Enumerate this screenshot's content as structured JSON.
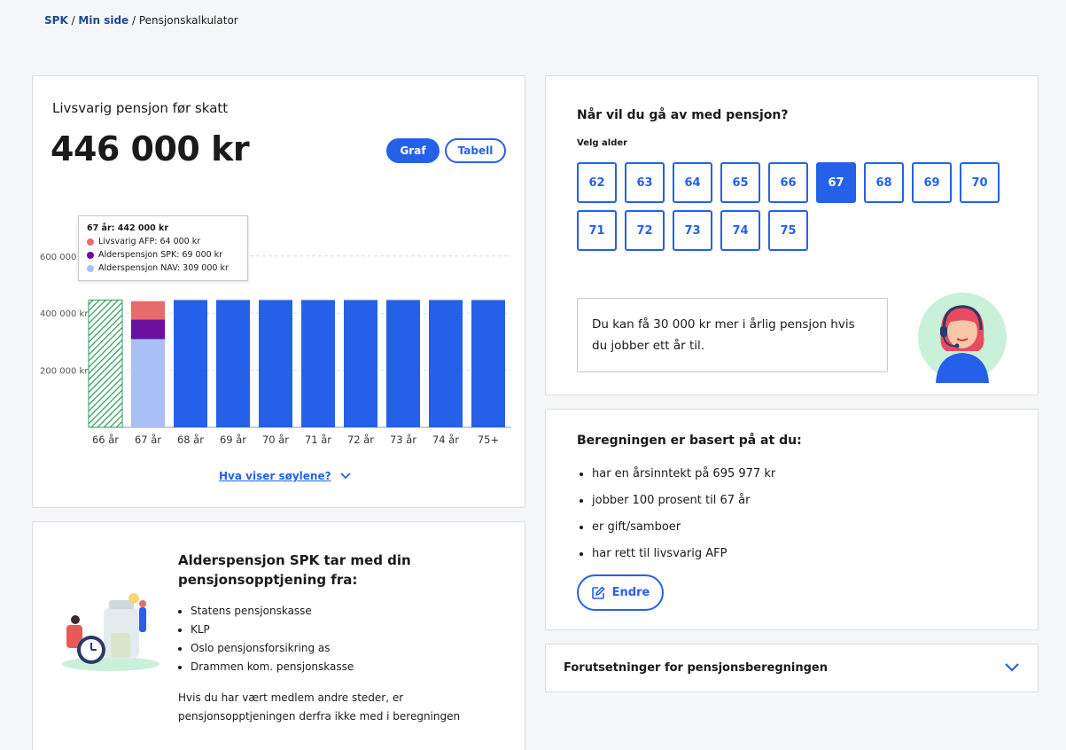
{
  "breadcrumb": {
    "home": "SPK",
    "sep1": " / ",
    "mypage": "Min side",
    "sep2": " / ",
    "current": "Pensjonskalkulator"
  },
  "chart_card": {
    "label": "Livsvarig pensjon før skatt",
    "amount": "446 000 kr",
    "toggle_graf": "Graf",
    "toggle_tabell": "Tabell",
    "more_link": "Hva viser søylene?"
  },
  "tooltip": {
    "title": "67 år: 442 000 kr",
    "rows": [
      {
        "label": "Livsvarig AFP: 64 000 kr",
        "color": "#e86b6b"
      },
      {
        "label": "Alderspensjon SPK: 69 000 kr",
        "color": "#6a0f9e"
      },
      {
        "label": "Alderspensjon NAV: 309 000 kr",
        "color": "#a9bff5"
      }
    ]
  },
  "chart_data": {
    "type": "bar",
    "categories": [
      "66 år",
      "67 år",
      "68 år",
      "69 år",
      "70 år",
      "71 år",
      "72 år",
      "73 år",
      "74 år",
      "75+"
    ],
    "yticks": [
      "200 000 kr",
      "400 000 kr",
      "600 000 kr"
    ],
    "ylim": [
      0,
      600000
    ],
    "colors": {
      "main": "#2561e8",
      "hatch": "#2e9e5b",
      "afp": "#e86b6b",
      "spk": "#6a0f9e",
      "nav": "#a9bff5"
    },
    "series": [
      {
        "name": "Livsvarig AFP",
        "values": [
          null,
          64000,
          null,
          null,
          null,
          null,
          null,
          null,
          null,
          null
        ]
      },
      {
        "name": "Alderspensjon SPK",
        "values": [
          null,
          69000,
          null,
          null,
          null,
          null,
          null,
          null,
          null,
          null
        ]
      },
      {
        "name": "Alderspensjon NAV",
        "values": [
          null,
          309000,
          null,
          null,
          null,
          null,
          null,
          null,
          null,
          null
        ]
      }
    ],
    "totals": [
      446000,
      442000,
      446000,
      446000,
      446000,
      446000,
      446000,
      446000,
      446000,
      446000
    ]
  },
  "info_card": {
    "title": "Alderspensjon SPK tar med din pensjonsopptjening fra:",
    "items": [
      "Statens pensjonskasse",
      "KLP",
      "Oslo pensjonsforsikring as",
      "Drammen kom. pensjonskasse"
    ],
    "footer": "Hvis du har vært medlem andre steder, er pensjonsopptjeningen derfra ikke med i beregningen"
  },
  "age_card": {
    "title": "Når vil du gå av med pensjon?",
    "subtitle": "Velg alder",
    "ages": [
      "62",
      "63",
      "64",
      "65",
      "66",
      "67",
      "68",
      "69",
      "70",
      "71",
      "72",
      "73",
      "74",
      "75"
    ],
    "selected": "67",
    "message": "Du kan få 30 000 kr mer i årlig pensjon hvis du jobber ett år til."
  },
  "basis_card": {
    "title": "Beregningen er basert på at du:",
    "items": [
      "har en årsinntekt på 695 977 kr",
      "jobber 100 prosent til 67 år",
      "er gift/samboer",
      "har rett til livsvarig AFP"
    ],
    "edit_button": "Endre"
  },
  "accordion": {
    "title": "Forutsetninger for pensjonsberegningen"
  }
}
